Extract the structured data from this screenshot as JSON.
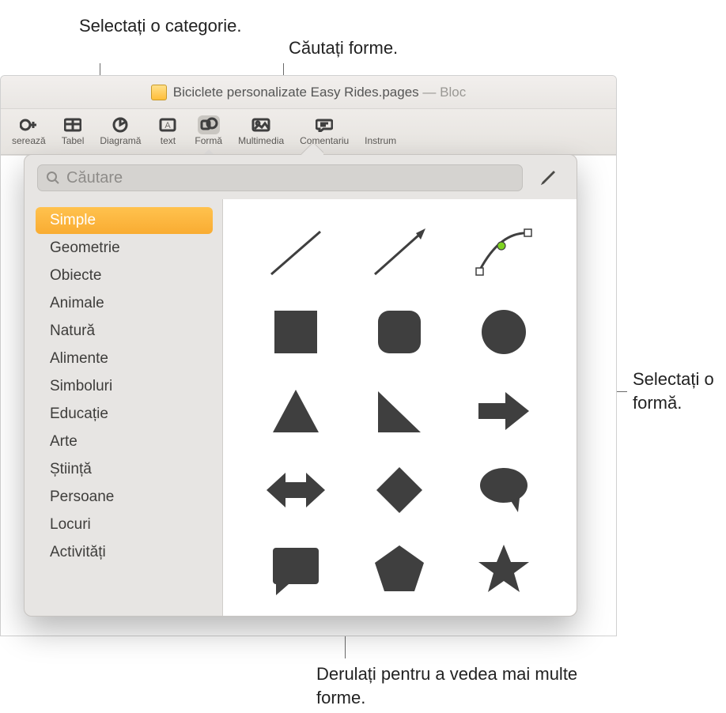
{
  "callouts": {
    "select_category": "Selectați o categorie.",
    "search_shapes": "Căutați forme.",
    "select_shape": "Selectați o formă.",
    "scroll_more": "Derulați pentru a vedea mai multe forme."
  },
  "window": {
    "doc_title_main": "Biciclete personalizate Easy Rides.pages",
    "doc_title_suffix": " — Bloc"
  },
  "toolbar": {
    "insert": "serează",
    "table": "Tabel",
    "chart": "Diagramă",
    "text": "text",
    "shape": "Formă",
    "media": "Multimedia",
    "comment": "Comentariu",
    "tools": "Instrum"
  },
  "search": {
    "placeholder": "Căutare"
  },
  "categories": [
    "Simple",
    "Geometrie",
    "Obiecte",
    "Animale",
    "Natură",
    "Alimente",
    "Simboluri",
    "Educație",
    "Arte",
    "Știință",
    "Persoane",
    "Locuri",
    "Activități"
  ],
  "shapes": [
    "line",
    "arrow-line",
    "curve-pen",
    "square",
    "rounded-square",
    "circle",
    "triangle",
    "right-triangle",
    "arrow-right",
    "arrow-double",
    "diamond",
    "speech-bubble",
    "callout-square",
    "pentagon",
    "star"
  ],
  "selected_category_index": 0
}
